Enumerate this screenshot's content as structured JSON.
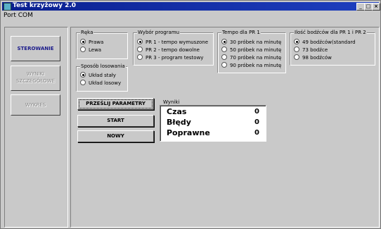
{
  "window": {
    "title": "Test krzyżowy 2.0",
    "controls": {
      "minimize": "_",
      "maximize": "□",
      "close": "×"
    }
  },
  "menu": {
    "items": [
      "Port COM"
    ]
  },
  "nav": {
    "sterowanie": "STEROWANIE",
    "wyniki_line1": "WYNIKI",
    "wyniki_line2": "SZCZEGÓŁOWE",
    "wykres": "WYKRES"
  },
  "reka": {
    "legend": "Ręka",
    "options": [
      "Prawa",
      "Lewa"
    ],
    "selected": 0
  },
  "losowanie": {
    "legend": "Sposób losowania",
    "options": [
      "Układ stały",
      "Układ losowy"
    ],
    "selected": 0
  },
  "program": {
    "legend": "Wybór programu",
    "options": [
      "PR 1 - tempo wymuszone",
      "PR 2 - tempo dowolne",
      "PR 3 - program testowy"
    ],
    "selected": 0
  },
  "tempo": {
    "legend": "Tempo dla PR 1",
    "options": [
      "30 próbek na minutę",
      "50 próbek na minutę",
      "70 próbek na minutę",
      "90 próbek na minutę"
    ],
    "selected": 0
  },
  "bodzce": {
    "legend": "Ilość bodźców dla PR 1 i PR 2",
    "options": [
      "49 bodźców(standard",
      "73 bodźce",
      "98 bodźców"
    ],
    "selected": 0
  },
  "actions": {
    "send": "PRZEŚLIJ PARAMETRY",
    "start": "START",
    "new": "NOWY"
  },
  "results": {
    "legend": "Wyniki",
    "rows": [
      {
        "label": "Czas",
        "value": "0"
      },
      {
        "label": "Błędy",
        "value": "0"
      },
      {
        "label": "Poprawne",
        "value": "0"
      }
    ]
  }
}
